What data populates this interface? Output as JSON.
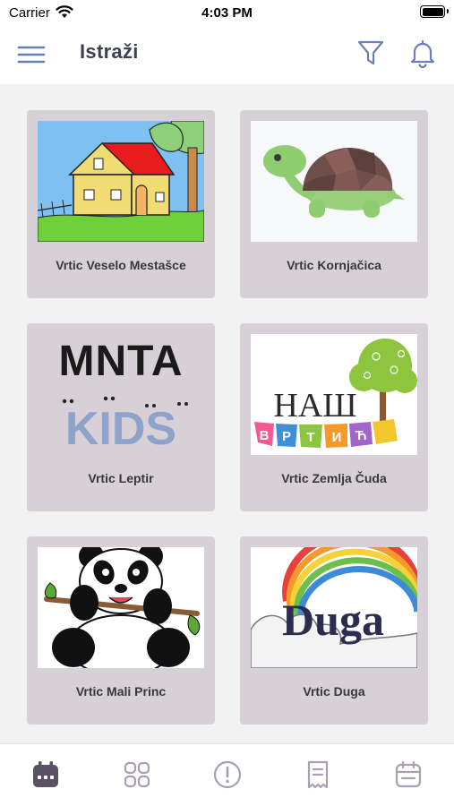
{
  "status_bar": {
    "carrier": "Carrier",
    "time": "4:03 PM"
  },
  "header": {
    "title": "Istraži"
  },
  "kindergartens": [
    {
      "name": "Vrtic Veselo Mestašce",
      "image": "house-illustration"
    },
    {
      "name": "Vrtic Kornjačica",
      "image": "turtle-illustration"
    },
    {
      "name": "Vrtic Leptir",
      "image": "minta-kids-logo",
      "logo_text": {
        "top": "MNTA",
        "bottom": "KIDS"
      }
    },
    {
      "name": "Vrtic Zemlja Čuda",
      "image": "nas-vrtic-logo",
      "logo_text": {
        "top": "НАШ",
        "letters": [
          "В",
          "Р",
          "Т",
          "И",
          "Ћ"
        ]
      }
    },
    {
      "name": "Vrtic Mali Princ",
      "image": "panda-illustration"
    },
    {
      "name": "Vrtic Duga",
      "image": "rainbow-logo",
      "logo_text": "Duga"
    }
  ],
  "tab_bar": {
    "tabs": [
      {
        "icon": "calendar-icon",
        "active": true
      },
      {
        "icon": "grid-icon",
        "active": false
      },
      {
        "icon": "alert-icon",
        "active": false
      },
      {
        "icon": "receipt-icon",
        "active": false
      },
      {
        "icon": "calendar-outline-icon",
        "active": false
      }
    ]
  },
  "colors": {
    "accent": "#6a7fb5",
    "card_bg": "#d7d1d7",
    "header_text": "#3c4050",
    "active_tab": "#5b5165",
    "inactive_tab": "#a8a0ae"
  }
}
